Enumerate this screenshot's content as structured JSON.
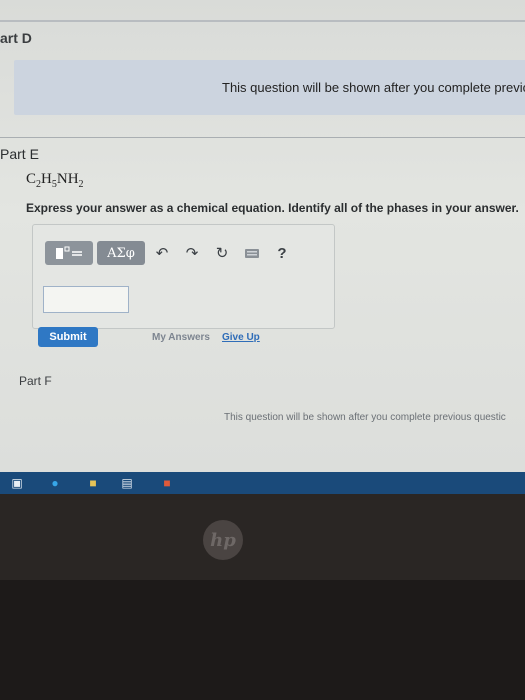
{
  "part_d": {
    "label": "art D",
    "hidden_message": "This question will be shown after you complete previous"
  },
  "part_e": {
    "label": "Part E",
    "formula": {
      "c": "C",
      "c_sub": "2",
      "h": "H",
      "h_sub": "5",
      "rest": "NH",
      "rest_sub": "2"
    },
    "instruction": "Express your answer as a chemical equation. Identify all of the phases in your answer.",
    "toolbar": {
      "greek_label": "ΑΣφ",
      "help_label": "?"
    },
    "answer_value": "",
    "submit_label": "Submit",
    "my_answers_label": "My Answers",
    "give_up_label": "Give Up"
  },
  "part_f": {
    "label": "Part F",
    "hidden_message": "This question will be shown after you complete previous questic"
  },
  "bezel": {
    "logo_text": "hp"
  },
  "colors": {
    "accent": "#2f78c4",
    "taskbar": "#1a4a7a",
    "panel": "#ccd4df"
  }
}
